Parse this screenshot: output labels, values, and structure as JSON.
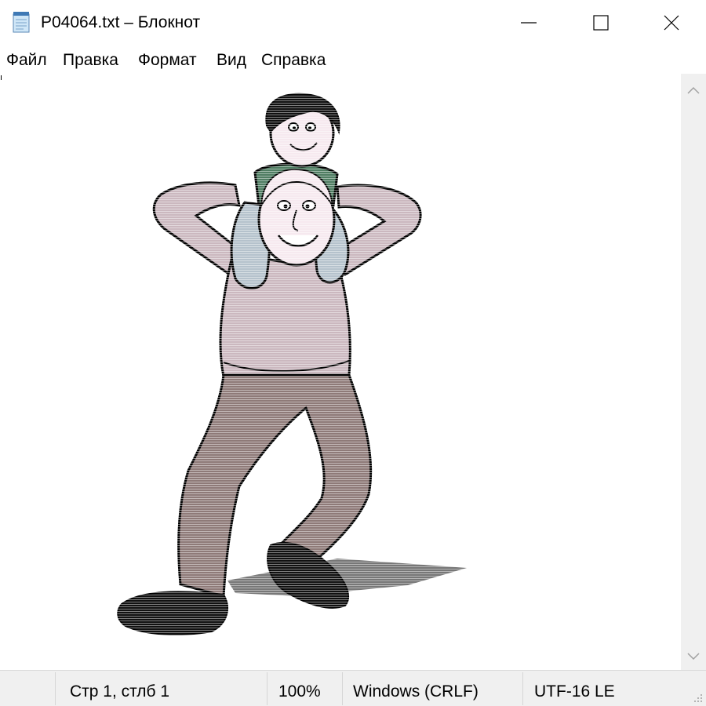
{
  "window": {
    "title": "P04064.txt – Блокнот"
  },
  "menu": {
    "items": [
      "Файл",
      "Правка",
      "Формат",
      "Вид",
      "Справка"
    ]
  },
  "editor": {
    "content": "ASCII art: a smiling man in a pink sweater and brown trousers carrying a boy on his shoulders"
  },
  "status": {
    "position": "Стр 1, стлб 1",
    "zoom": "100%",
    "line_endings": "Windows (CRLF)",
    "encoding": "UTF-16 LE"
  },
  "icons": {
    "app": "notepad-icon",
    "minimize": "minimize-icon",
    "maximize": "maximize-icon",
    "close": "close-icon"
  },
  "colors": {
    "sweater": "#cbb8bf",
    "trousers": "#8e7a78",
    "child_shirt": "#4f7d62",
    "child_legs": "#b5c2cc",
    "shoes": "#111111"
  }
}
